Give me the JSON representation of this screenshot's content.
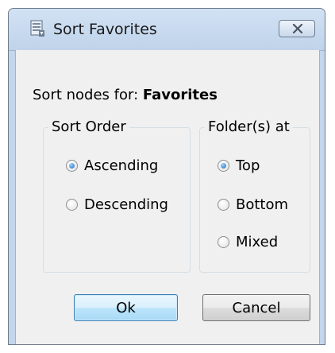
{
  "window": {
    "title": "Sort Favorites",
    "icon": "sort-app-icon",
    "close_icon": "close-x-icon"
  },
  "prompt": {
    "label": "Sort nodes for: ",
    "value": "Favorites"
  },
  "sort_order": {
    "legend": "Sort Order",
    "options": [
      {
        "label": "Ascending",
        "checked": true
      },
      {
        "label": "Descending",
        "checked": false
      }
    ]
  },
  "folders_at": {
    "legend": "Folder(s) at",
    "options": [
      {
        "label": "Top",
        "checked": true
      },
      {
        "label": "Bottom",
        "checked": false
      },
      {
        "label": "Mixed",
        "checked": false
      }
    ]
  },
  "buttons": {
    "ok": "Ok",
    "cancel": "Cancel"
  }
}
